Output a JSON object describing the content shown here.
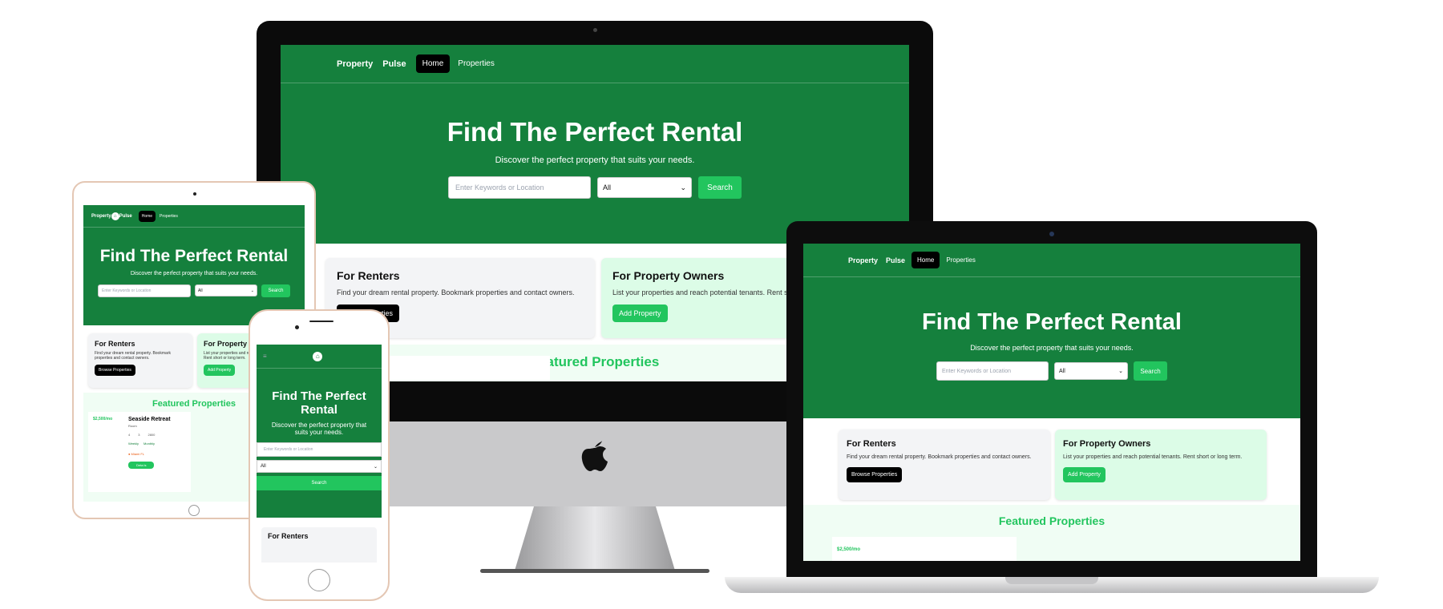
{
  "site": {
    "brand_part1": "Property",
    "brand_part2": "Pulse",
    "brand_tablet": "Property Pulse",
    "nav_home": "Home",
    "nav_properties": "Properties",
    "hero_title": "Find The Perfect Rental",
    "hero_subtitle": "Discover the perfect property that suits your needs.",
    "search_placeholder": "Enter Keywords or Location",
    "type_selected": "All",
    "search_button": "Search",
    "renters_title": "For Renters",
    "renters_text": "Find your dream rental property. Bookmark properties and contact owners.",
    "renters_button": "Browse Properties",
    "owners_title": "For Property Owners",
    "owners_text": "List your properties and reach potential tenants. Rent short or long term.",
    "owners_button": "Add Property",
    "featured_title": "Featured Properties",
    "phone_hero_line1": "Find The Perfect",
    "phone_hero_line2": "Rental",
    "phone_sub_line1": "Discover the perfect property that",
    "phone_sub_line2": "suits your needs.",
    "imac_cropped_button": "erties",
    "imac_cropped_owners_text": "List your properties and reach potential tenants. Rent sh",
    "laptop_cropped_price": "$2,500/mo"
  },
  "property_card": {
    "price": "$2,500/mo",
    "name": "Seaside Retreat",
    "type": "Room",
    "beds": "4",
    "baths": "3",
    "sqft": "2800",
    "rate_weekly": "Weekly",
    "rate_monthly": "Monthly",
    "location": "Miami FL",
    "details_button": "Deta ls"
  },
  "colors": {
    "primary_green": "#15803d",
    "accent_green": "#22c55e",
    "light_green": "#f0fdf4",
    "card_gray": "#f3f4f6"
  }
}
